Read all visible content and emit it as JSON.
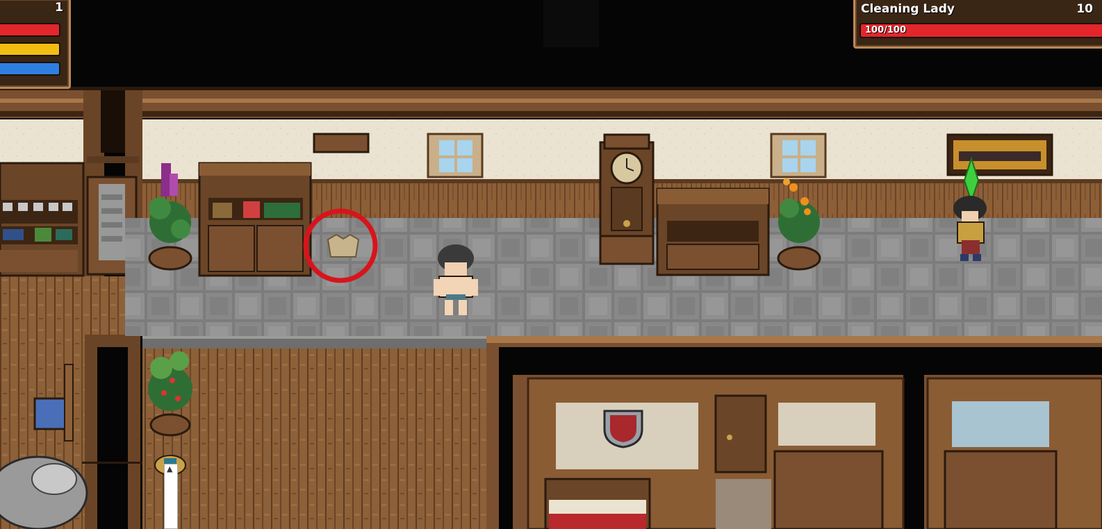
{
  "player": {
    "level": "1",
    "hp_ratio": 1.0,
    "stamina_ratio": 1.0,
    "mana_ratio": 1.0
  },
  "target": {
    "name": "Cleaning Lady",
    "level": "10",
    "hp_text": "100/100",
    "hp_ratio": 1.0
  },
  "colors": {
    "hp": "#e3262b",
    "stamina": "#f2bd12",
    "mana": "#2f7fe0",
    "wall_cream": "#eae2d0",
    "wood_dark": "#5a3a20",
    "wood_mid": "#8a5c34",
    "stone": "#858585",
    "marker_ring": "#d7141c"
  },
  "scene": {
    "marker": "circled-item-marker",
    "item": "cloth-shirt-icon"
  }
}
